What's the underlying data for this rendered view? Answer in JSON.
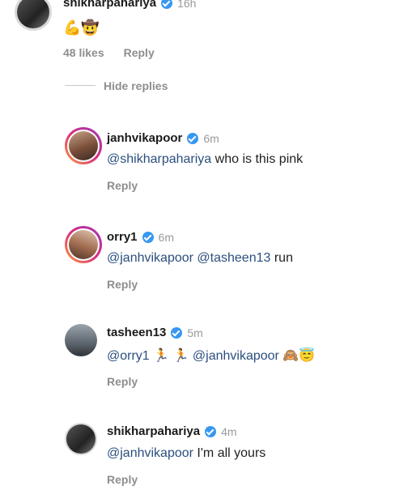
{
  "top_comment": {
    "username": "shikharpahariya",
    "time": "16h",
    "text": "💪🤠",
    "likes": "48 likes",
    "reply_label": "Reply"
  },
  "hide_replies_label": "Hide replies",
  "replies": [
    {
      "username": "janhvikapoor",
      "time": "6m",
      "mention": "@shikharpahariya",
      "text": " who is this pink",
      "reply_label": "Reply"
    },
    {
      "username": "orry1",
      "time": "6m",
      "mention": "@janhvikapoor @tasheen13",
      "text": " run",
      "reply_label": "Reply"
    },
    {
      "username": "tasheen13",
      "time": "5m",
      "mention": "@orry1",
      "middle": " 🏃 🏃 ",
      "mention2": "@janhvikapoor",
      "text": " 🙈😇",
      "reply_label": "Reply"
    },
    {
      "username": "shikharpahariya",
      "time": "4m",
      "mention": "@janhvikapoor",
      "text": " I'm all yours",
      "reply_label": "Reply"
    }
  ],
  "colors": {
    "verified": "#3897f0",
    "mention": "#2b4f7e",
    "meta": "#8e8e8e"
  }
}
